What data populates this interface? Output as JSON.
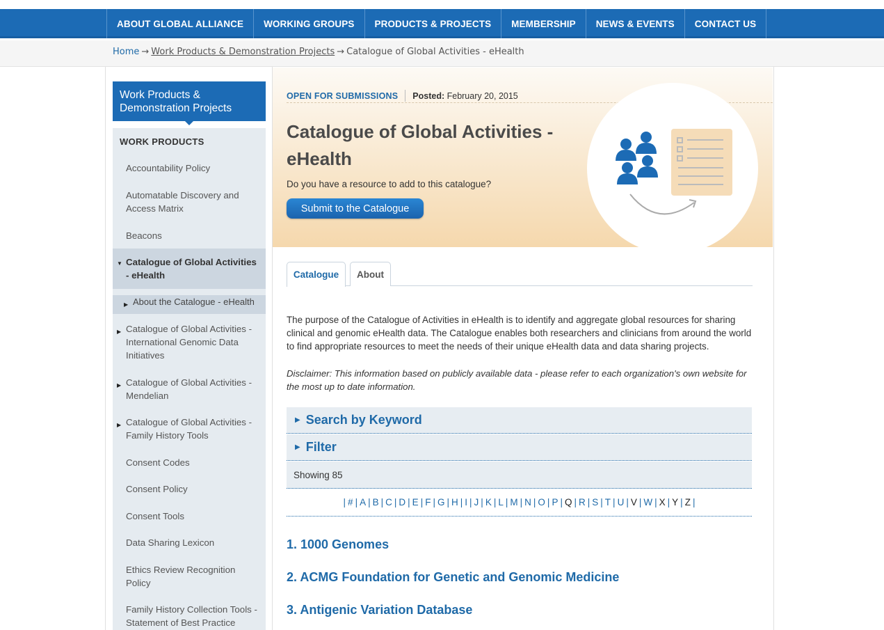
{
  "nav": [
    "ABOUT GLOBAL ALLIANCE",
    "WORKING GROUPS",
    "PRODUCTS & PROJECTS",
    "MEMBERSHIP",
    "NEWS & EVENTS",
    "CONTACT US"
  ],
  "breadcrumb": {
    "home": "Home",
    "parent": "Work Products & Demonstration Projects",
    "current": "Catalogue of Global Activities - eHealth",
    "arrow": "→"
  },
  "sidebar": {
    "heading": "Work Products & Demonstration Projects",
    "section": "WORK PRODUCTS",
    "items": [
      "Accountability Policy",
      "Automatable Discovery and Access Matrix",
      "Beacons",
      "Catalogue of Global Activities - eHealth",
      "About the Catalogue - eHealth",
      "Catalogue of Global Activities - International Genomic Data Initiatives",
      "Catalogue of Global Activities - Mendelian",
      "Catalogue of Global Activities - Family History Tools",
      "Consent Codes",
      "Consent Policy",
      "Consent Tools",
      "Data Sharing Lexicon",
      "Ethics Review Recognition Policy",
      "Family History Collection Tools - Statement of Best Practice"
    ]
  },
  "hero": {
    "status": "OPEN FOR SUBMISSIONS",
    "posted_label": "Posted:",
    "posted_date": "February 20, 2015",
    "title": "Catalogue of Global Activities - eHealth",
    "question": "Do you have a resource to add to this catalogue?",
    "button": "Submit to the Catalogue"
  },
  "tabs": [
    "Catalogue",
    "About"
  ],
  "intro": "The purpose of the Catalogue of Activities in eHealth is to identify and aggregate global resources for sharing clinical and genomic eHealth data. The Catalogue enables both researchers and clinicians from around the world to find appropriate resources to meet the needs of their unique eHealth data and data sharing projects.",
  "disclaimer": "Disclaimer: This information based on publicly available data - please refer to each organization's own website for the most up to date information.",
  "accordions": [
    "Search by Keyword",
    "Filter"
  ],
  "showing": "Showing 85",
  "alphabet": [
    {
      "l": "#",
      "link": true
    },
    {
      "l": "A",
      "link": true
    },
    {
      "l": "B",
      "link": true
    },
    {
      "l": "C",
      "link": true
    },
    {
      "l": "D",
      "link": true
    },
    {
      "l": "E",
      "link": true
    },
    {
      "l": "F",
      "link": true
    },
    {
      "l": "G",
      "link": true
    },
    {
      "l": "H",
      "link": true
    },
    {
      "l": "I",
      "link": true
    },
    {
      "l": "J",
      "link": true
    },
    {
      "l": "K",
      "link": true
    },
    {
      "l": "L",
      "link": true
    },
    {
      "l": "M",
      "link": true
    },
    {
      "l": "N",
      "link": true
    },
    {
      "l": "O",
      "link": true
    },
    {
      "l": "P",
      "link": true
    },
    {
      "l": "Q",
      "link": false
    },
    {
      "l": "R",
      "link": true
    },
    {
      "l": "S",
      "link": true
    },
    {
      "l": "T",
      "link": true
    },
    {
      "l": "U",
      "link": true
    },
    {
      "l": "V",
      "link": false
    },
    {
      "l": "W",
      "link": true
    },
    {
      "l": "X",
      "link": false
    },
    {
      "l": "Y",
      "link": false
    },
    {
      "l": "Z",
      "link": false
    }
  ],
  "results": [
    "1. 1000 Genomes",
    "2. ACMG Foundation for Genetic and Genomic Medicine",
    "3. Antigenic Variation Database"
  ],
  "colors": {
    "brand": "#1c6bb5",
    "link": "#1f6aa8",
    "sidebar": "#e5ebf0",
    "hero_bottom": "#f5d8ad"
  }
}
